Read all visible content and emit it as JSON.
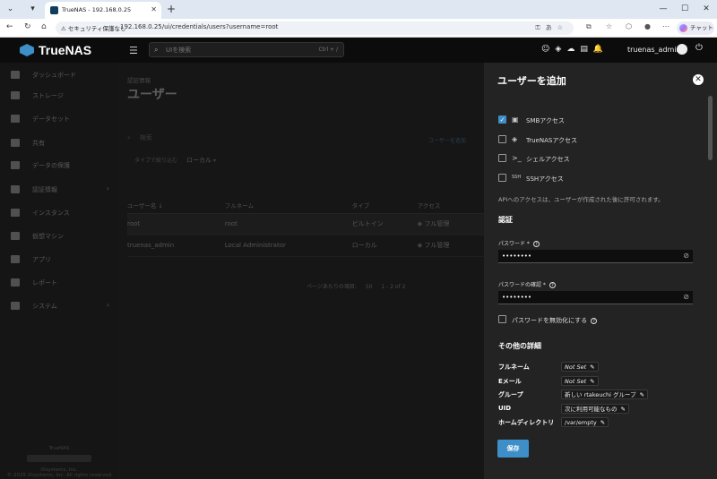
{
  "browser": {
    "tab_title": "TrueNAS - 192.168.0.25",
    "security_label": "セキュリティ保護なし",
    "url": "192.168.0.25/ui/credentials/users?username=root",
    "chat_label": "チャット"
  },
  "app": {
    "brand": "TrueNAS",
    "search_placeholder": "UIを検索",
    "search_shortcut": "Ctrl + /",
    "username": "truenas_admin"
  },
  "sidebar": {
    "items": [
      {
        "label": "ダッシュボード"
      },
      {
        "label": "ストレージ"
      },
      {
        "label": "データセット"
      },
      {
        "label": "共有"
      },
      {
        "label": "データの保護"
      },
      {
        "label": "認証情報"
      },
      {
        "label": "インスタンス"
      },
      {
        "label": "仮想マシン"
      },
      {
        "label": "アプリ"
      },
      {
        "label": "レポート"
      },
      {
        "label": "システム"
      }
    ],
    "footer_name": "TrueNAS",
    "footer_line1": "iXsystems, Inc.",
    "footer_line2": "© 2025 iXsystems, Inc. All rights reserved"
  },
  "main": {
    "breadcrumb": "認証情報",
    "title": "ユーザー",
    "search_placeholder": "検索",
    "add_button": "ユーザーを追加",
    "filter_label": "タイプで絞り込む",
    "filter_value": "ローカル",
    "columns": [
      "ユーザー名 ↓",
      "フルネーム",
      "タイプ",
      "アクセス"
    ],
    "rows": [
      {
        "username": "root",
        "fullname": "root",
        "type": "ビルトイン",
        "access": "フル管理"
      },
      {
        "username": "truenas_admin",
        "fullname": "Local Administrator",
        "type": "ローカル",
        "access": "フル管理"
      }
    ],
    "pager_label": "ページあたりの項目:",
    "pager_size": "50",
    "pager_range": "1 - 2 of 2"
  },
  "panel": {
    "title": "ユーザーを追加",
    "access": [
      {
        "label": "SMBアクセス",
        "checked": true,
        "icon": "smb-icon"
      },
      {
        "label": "TrueNASアクセス",
        "checked": false,
        "icon": "truenas-icon"
      },
      {
        "label": "シェルアクセス",
        "checked": false,
        "icon": "terminal-icon"
      },
      {
        "label": "SSHアクセス",
        "checked": false,
        "icon": "ssh-icon"
      }
    ],
    "access_note": "APIへのアクセスは、ユーザーが作成された後に許可されます。",
    "auth_section": "認証",
    "password_label": "パスワード *",
    "password_value": "••••••••",
    "password_confirm_label": "パスワードの確認 *",
    "password_confirm_value": "••••••••",
    "disable_password_label": "パスワードを無効化にする",
    "other_section": "その他の詳細",
    "details": [
      {
        "key": "フルネーム",
        "value": "Not Set",
        "italic": true
      },
      {
        "key": "Eメール",
        "value": "Not Set",
        "italic": true
      },
      {
        "key": "グループ",
        "value": "新しい rtakeuchi グループ",
        "italic": false
      },
      {
        "key": "UID",
        "value": "次に利用可能なもの",
        "italic": false
      },
      {
        "key": "ホームディレクトリ",
        "value": "/var/empty",
        "italic": false
      }
    ],
    "save_label": "保存"
  },
  "colors": {
    "accent": "#3e8ec7",
    "panel_bg": "#232323",
    "topbar_bg": "#0c0c0c"
  }
}
